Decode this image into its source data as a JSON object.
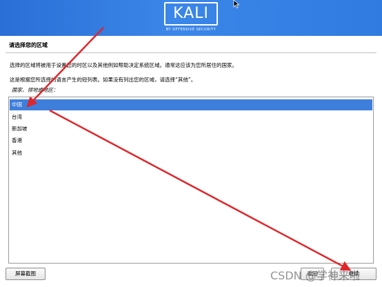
{
  "banner": {
    "logo_text": "KALI",
    "logo_subtext": "BY OFFENSIVE SECURITY",
    "background_color": "#2f7be0"
  },
  "page": {
    "title": "请选择您的区域",
    "description_1": "选择的区域将被用于设置您的时区以及其他例如帮助决定系统区域。通常这应该为您所居住的国家。",
    "description_2": "这是根据您所选择的语言产生的短列表。如果没有列出您的区域，请选择“其他”。",
    "list_label": "国家、领地或地区："
  },
  "list": {
    "items": [
      {
        "label": "中国",
        "selected": true
      },
      {
        "label": "台湾",
        "selected": false
      },
      {
        "label": "新加坡",
        "selected": false
      },
      {
        "label": "香港",
        "selected": false
      },
      {
        "label": "其他",
        "selected": false
      }
    ],
    "selection_color": "#3f7fdc"
  },
  "buttons": {
    "screenshot_label": "屏幕截图",
    "back_label": "返回",
    "continue_label": "继续"
  },
  "watermark": {
    "text": "CSDN @学神来啦"
  },
  "annotation": {
    "arrow_color": "#e0262b"
  }
}
